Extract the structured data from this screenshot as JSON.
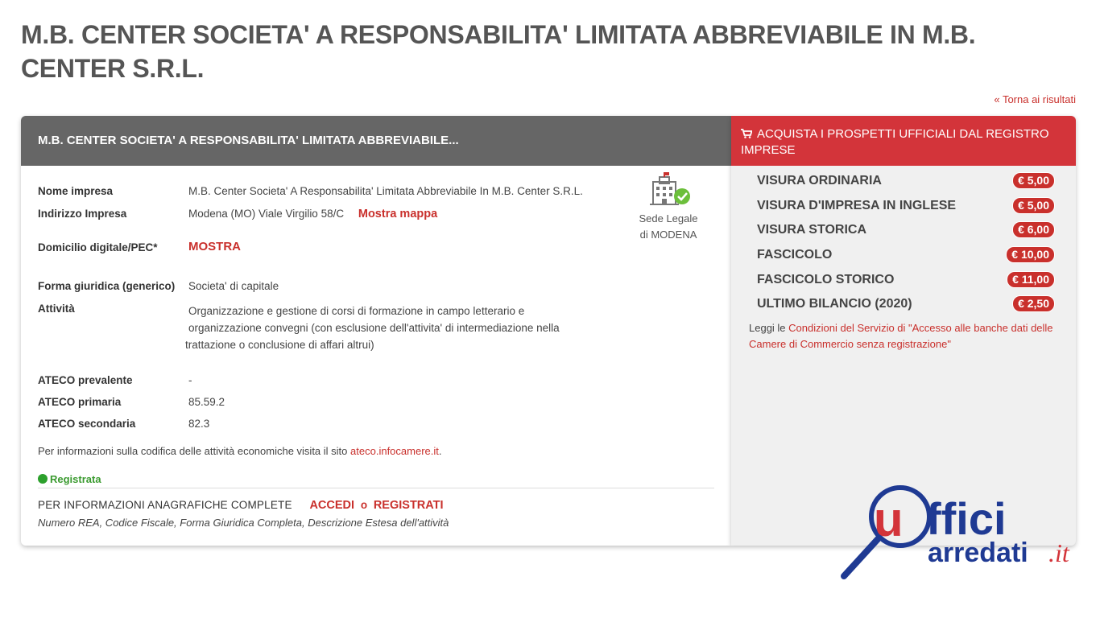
{
  "page": {
    "title": "M.B. CENTER SOCIETA' A RESPONSABILITA' LIMITATA ABBREVIABILE IN M.B. CENTER S.R.L.",
    "back_link": "« Torna ai risultati"
  },
  "card": {
    "header": "M.B. CENTER SOCIETA' A RESPONSABILITA' LIMITATA ABBREVIABILE...",
    "fields": {
      "nome_label": "Nome impresa",
      "nome_value": "M.B. Center Societa' A Responsabilita' Limitata Abbreviabile In M.B. Center S.R.L.",
      "indirizzo_label": "Indirizzo Impresa",
      "indirizzo_value": "Modena (MO) Viale Virgilio 58/C",
      "mappa_link": "Mostra mappa",
      "pec_label": "Domicilio digitale/PEC*",
      "pec_link": "MOSTRA",
      "forma_label": "Forma giuridica (generico)",
      "forma_value": "Societa' di capitale",
      "attivita_label": "Attività",
      "attivita_line1": "Organizzazione e gestione di corsi di formazione in campo letterario e",
      "attivita_line2": "organizzazione convegni (con esclusione dell'attivita' di intermediazione nella",
      "attivita_line3": "trattazione o conclusione di affari altrui)",
      "ateco_prev_label": "ATECO prevalente",
      "ateco_prev_value": "-",
      "ateco_prim_label": "ATECO primaria",
      "ateco_prim_value": "85.59.2",
      "ateco_sec_label": "ATECO secondaria",
      "ateco_sec_value": "82.3",
      "ateco_info": "Per informazioni sulla codifica delle attività economiche visita il sito",
      "ateco_site": "ateco.infocamere.it",
      "ateco_period": "."
    },
    "sede": {
      "line1": "Sede Legale",
      "line2": "di MODENA"
    },
    "status": "Registrata",
    "info": {
      "label": "PER INFORMAZIONI ANAGRAFICHE COMPLETE",
      "accedi": "ACCEDI",
      "o": "o",
      "registrati": "REGISTRATI",
      "sub": "Numero REA, Codice Fiscale, Forma Giuridica Completa, Descrizione Estesa dell'attività"
    }
  },
  "panel": {
    "header": "ACQUISTA I PROSPETTI UFFICIALI DAL REGISTRO IMPRESE",
    "products": [
      {
        "name": "VISURA ORDINARIA",
        "price": "€ 5,00"
      },
      {
        "name": "VISURA D'IMPRESA IN INGLESE",
        "price": "€ 5,00"
      },
      {
        "name": "VISURA STORICA",
        "price": "€ 6,00"
      },
      {
        "name": "FASCICOLO",
        "price": "€ 10,00"
      },
      {
        "name": "FASCICOLO STORICO",
        "price": "€ 11,00"
      },
      {
        "name": "ULTIMO BILANCIO (2020)",
        "price": "€ 2,50"
      }
    ],
    "note_prefix": "Leggi le",
    "note_link": "Condizioni del Servizio di \"Accesso alle banche dati delle Camere di Commercio senza registrazione\""
  },
  "logo": {
    "part1": "ffici",
    "part2": "arredati",
    "part3": ".it"
  },
  "colors": {
    "accent": "#c9302c",
    "header_gray": "#666666",
    "panel_red": "#d3343a",
    "status_green": "#2ca02c"
  }
}
